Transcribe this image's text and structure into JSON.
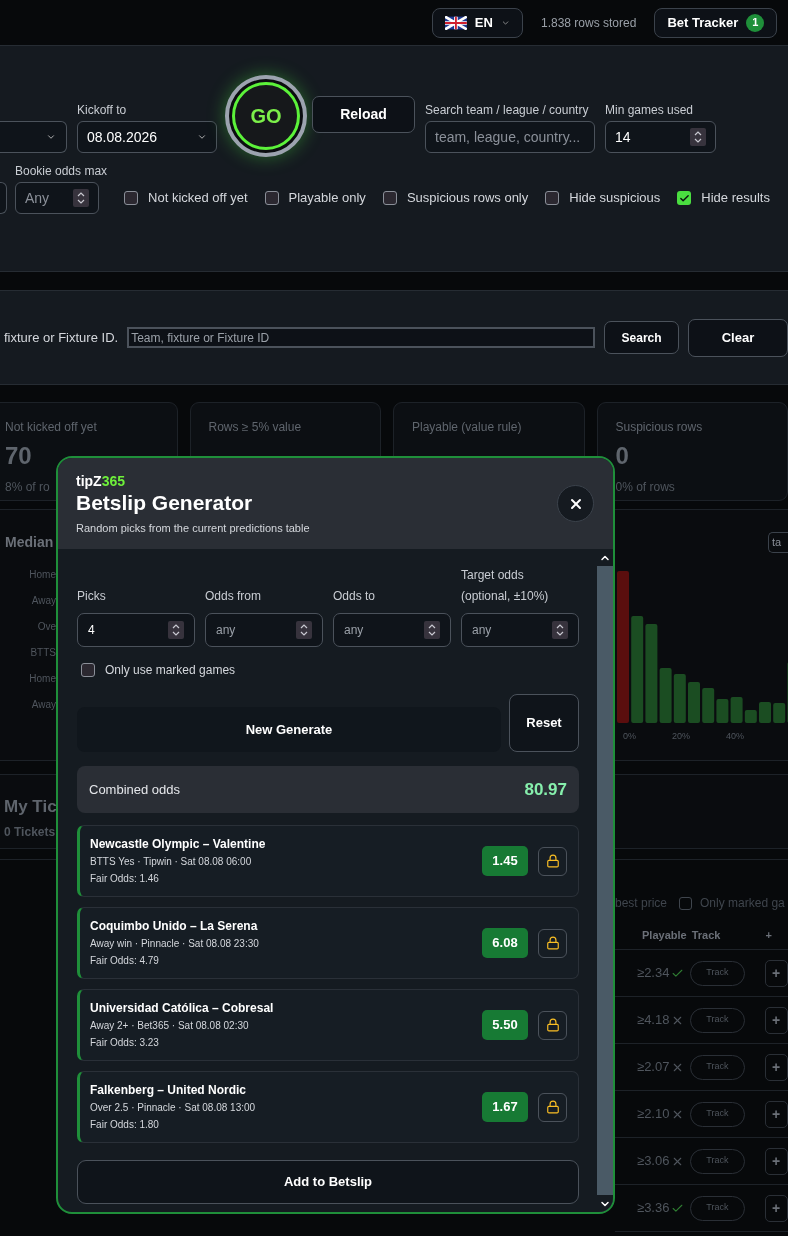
{
  "header": {
    "language": "EN",
    "rows_stored": "1.838 rows stored",
    "tracker_button": "Bet Tracker",
    "tracker_badge": "1"
  },
  "filters": {
    "kickoff_to": {
      "label": "Kickoff to",
      "value": "08.08.2026"
    },
    "go_button": "GO",
    "reload_button": "Reload",
    "search": {
      "label": "Search team / league / country",
      "placeholder": "team, league, country..."
    },
    "min_games": {
      "label": "Min games used",
      "value": "14"
    },
    "bookie_max": {
      "label": "Bookie odds max",
      "placeholder": "Any"
    },
    "checkboxes": [
      {
        "label": "Not kicked off yet",
        "checked": false
      },
      {
        "label": "Playable only",
        "checked": false
      },
      {
        "label": "Suspicious rows only",
        "checked": false
      },
      {
        "label": "Hide suspicious",
        "checked": false
      },
      {
        "label": "Hide results",
        "checked": true
      }
    ]
  },
  "fixture_search": {
    "hint": "fixture or Fixture ID.",
    "placeholder": "Team, fixture or Fixture ID",
    "search_button": "Search",
    "clear_button": "Clear"
  },
  "stats": [
    {
      "label": "Not kicked off yet",
      "value": "70",
      "note": "8% of ro"
    },
    {
      "label": "Rows ≥ 5% value"
    },
    {
      "label": "Playable (value rule)"
    },
    {
      "label": "Suspicious rows",
      "value": "0",
      "note": "0% of rows"
    }
  ],
  "median_panel": {
    "title": "Median",
    "rows": [
      "Home",
      "Away",
      "Ove",
      "BTTS",
      "Home",
      "Away"
    ],
    "tab_button": "ta",
    "axis_labels": [
      "0%",
      "20%",
      "40%"
    ]
  },
  "tickets": {
    "title": "My Tic",
    "count": "0 Tickets"
  },
  "table": {
    "best_price": "best price",
    "marked_filter": {
      "label": "Only marked ga",
      "checked": false
    },
    "columns": [
      "Playable",
      "Track",
      "+"
    ],
    "rows": [
      {
        "playable": "≥2.34",
        "ok": true,
        "track": "Track",
        "add": "+"
      },
      {
        "playable": "≥4.18",
        "ok": false,
        "track": "Track",
        "add": "+"
      },
      {
        "playable": "≥2.07",
        "ok": false,
        "track": "Track",
        "add": "+"
      },
      {
        "playable": "≥2.10",
        "ok": false,
        "track": "Track",
        "add": "+"
      },
      {
        "playable": "≥3.06",
        "ok": false,
        "track": "Track",
        "add": "+"
      },
      {
        "playable": "≥3.36",
        "ok": true,
        "track": "Track",
        "add": "+"
      }
    ]
  },
  "modal": {
    "logo": {
      "prefix": "tipZ",
      "accent": "365"
    },
    "title": "Betslip Generator",
    "subtitle": "Random picks from the current predictions table",
    "fields": [
      {
        "label": "Picks",
        "value": "4"
      },
      {
        "label": "Odds from",
        "placeholder": "any"
      },
      {
        "label": "Odds to",
        "placeholder": "any"
      },
      {
        "label": "Target odds (optional, ±10%)",
        "placeholder": "any"
      }
    ],
    "marked_only": {
      "label": "Only use marked games",
      "checked": false
    },
    "generate_button": "New Generate",
    "reset_button": "Reset",
    "combined": {
      "label": "Combined odds",
      "value": "80.97"
    },
    "picks": [
      {
        "match": "Newcastle Olympic – Valentine",
        "details": "BTTS Yes · Tipwin · Sat 08.08 06:00",
        "fair": "Fair Odds: 1.46",
        "odds": "1.45"
      },
      {
        "match": "Coquimbo Unido – La Serena",
        "details": "Away win · Pinnacle · Sat 08.08 23:30",
        "fair": "Fair Odds: 4.79",
        "odds": "6.08"
      },
      {
        "match": "Universidad Católica – Cobresal",
        "details": "Away 2+ · Bet365 · Sat 08.08 02:30",
        "fair": "Fair Odds: 3.23",
        "odds": "5.50"
      },
      {
        "match": "Falkenberg – United Nordic",
        "details": "Over 2.5 · Pinnacle · Sat 08.08 13:00",
        "fair": "Fair Odds: 1.80",
        "odds": "1.67"
      }
    ],
    "add_button": "Add to Betslip"
  }
}
